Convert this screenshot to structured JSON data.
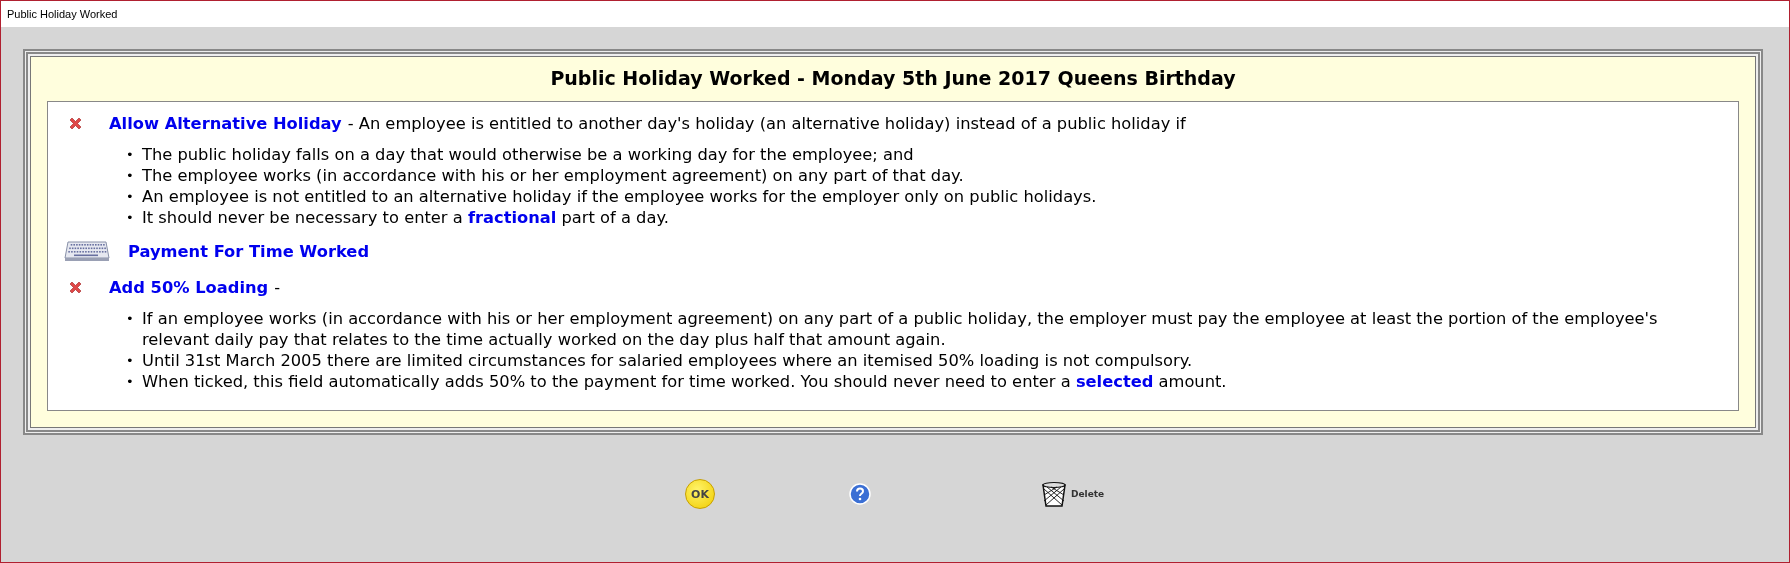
{
  "window": {
    "title": "Public Holiday Worked"
  },
  "panel": {
    "title": "Public Holiday Worked - Monday 5th June 2017 Queens Birthday"
  },
  "sections": [
    {
      "kind": "checkbox",
      "checked": false,
      "label": "Allow Alternative Holiday",
      "description": "- An employee is entitled to another day's holiday (an alternative holiday) instead of a public holiday if",
      "bullets": [
        {
          "marker": "•",
          "text": "The public holiday falls on a day that would otherwise be a working day for the employee; and"
        },
        {
          "marker": "•",
          "text": "The employee works (in accordance with his or her employment agreement) on any part of that day."
        },
        {
          "marker": "•",
          "text": "An employee is not entitled to an alternative holiday if the employee works for the employer only on public holidays."
        },
        {
          "marker": "•",
          "text": "It should never be necessary to enter a **fractional** part of a day."
        }
      ]
    },
    {
      "kind": "entry",
      "label": "Payment For Time Worked"
    },
    {
      "kind": "checkbox",
      "checked": false,
      "label": "Add 50% Loading",
      "description": "-",
      "bullets": [
        {
          "marker": "•",
          "text": "If an employee works (in accordance with his or her employment agreement) on any part of a public holiday, the employer must pay the employee at least the portion of the employee's relevant daily pay that relates to the time actually worked on the day plus half that amount again."
        },
        {
          "marker": "•",
          "text": "Until 31st March 2005 there are limited circumstances for salaried employees where an itemised 50% loading is not compulsory."
        },
        {
          "marker": "•",
          "text": "When ticked, this field automatically adds 50% to the payment for time worked. You should never need to enter a **selected** amount."
        }
      ]
    }
  ],
  "buttons": [
    {
      "kind": "ok",
      "label": "OK"
    },
    {
      "kind": "help"
    },
    {
      "kind": "delete",
      "label": "Delete"
    }
  ]
}
